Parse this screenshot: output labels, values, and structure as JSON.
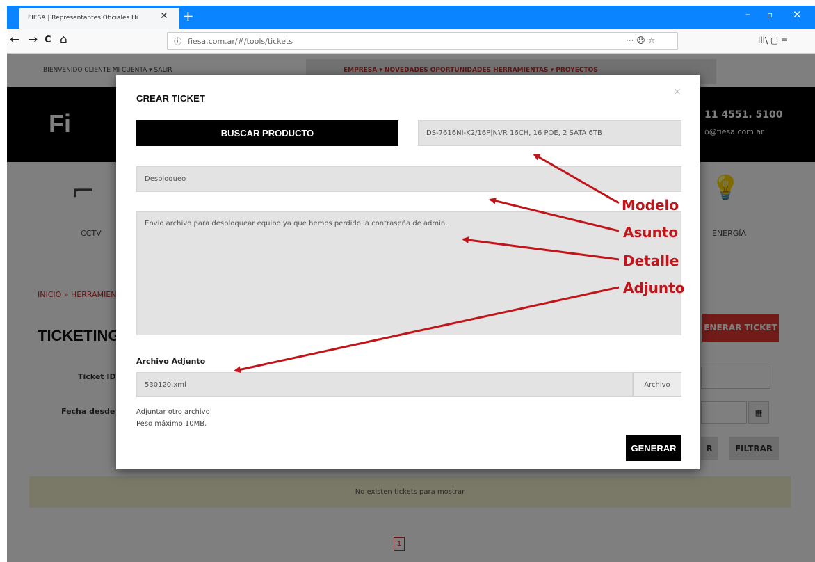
{
  "browser": {
    "tab_title": "FIESA | Representantes Oficiales Hi",
    "tab_close": "✕",
    "new_tab": "+",
    "url": "fiesa.com.ar/#/tools/tickets",
    "nav_back": "←",
    "nav_forward": "→",
    "nav_reload": "C",
    "nav_home": "⌂",
    "url_actions": "··· ☺ ☆",
    "toolbar_right": "lll\\  ▢  ≡",
    "win_min": "–",
    "win_max": "▫",
    "win_close": "✕"
  },
  "site": {
    "welcome": "BIENVENIDO CLIENTE   MI CUENTA ▾   SALIR",
    "menu": "EMPRESA ▾   NOVEDADES   OPORTUNIDADES   HERRAMIENTAS ▾   PROYECTOS",
    "logo": "Fi",
    "phone": "11 4551. 5100",
    "email": "o@fiesa.com.ar",
    "cat_left": "CCTV",
    "cat_right": "ENERGÍA",
    "breadcrumb": "INICIO » HERRAMIENT",
    "heading": "TICKETING",
    "generate_ticket": "ENERAR TICKET",
    "label_ticket": "Ticket ID",
    "label_fecha": "Fecha desde",
    "btn_r": "R",
    "btn_filtrar": "FILTRAR",
    "calendar_icon": "▦",
    "no_tickets": "No existen tickets para mostrar",
    "page_number": "1"
  },
  "modal": {
    "title": "CREAR TICKET",
    "close": "×",
    "search_button": "BUSCAR PRODUCTO",
    "modelo_value": "DS-7616NI-K2/16P|NVR 16CH, 16 POE, 2 SATA 6TB",
    "asunto_value": "Desbloqueo",
    "detalle_value": "Envio archivo para desbloquear equipo ya que hemos perdido la contraseña de admin.",
    "adjunto_label": "Archivo Adjunto",
    "file_value": "530120.xml",
    "file_button": "Archivo",
    "add_file_link": "Adjuntar otro archivo",
    "max_size": "Peso máximo 10MB.",
    "submit_button": "GENERAR"
  },
  "annotations": {
    "modelo": "Modelo",
    "asunto": "Asunto",
    "detalle": "Detalle",
    "adjunto": "Adjunto",
    "color": "#c0161b"
  }
}
